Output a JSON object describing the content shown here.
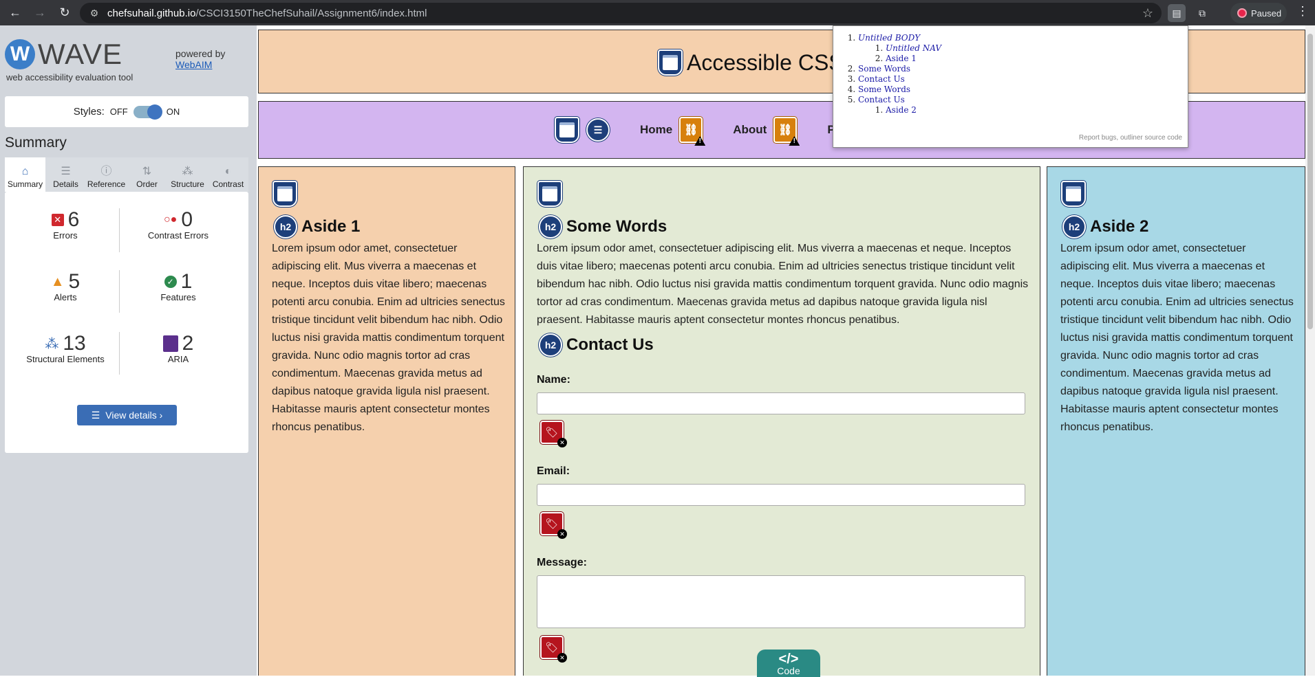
{
  "browser": {
    "url_host": "chefsuhail.github.io",
    "url_path": "/CSCI3150TheChefSuhail/Assignment6/index.html",
    "profile_status": "Paused"
  },
  "wave": {
    "logo_text": "WAVE",
    "tagline": "web accessibility evaluation tool",
    "powered_by": "powered by",
    "webaim": "WebAIM",
    "styles_label": "Styles:",
    "styles_off": "OFF",
    "styles_on": "ON",
    "summary_title": "Summary",
    "tabs": [
      {
        "label": "Summary",
        "icon": "home-icon"
      },
      {
        "label": "Details",
        "icon": "list-icon"
      },
      {
        "label": "Reference",
        "icon": "info-icon"
      },
      {
        "label": "Order",
        "icon": "order-icon"
      },
      {
        "label": "Structure",
        "icon": "structure-icon"
      },
      {
        "label": "Contrast",
        "icon": "contrast-icon"
      }
    ],
    "stats": {
      "errors": {
        "value": "6",
        "label": "Errors"
      },
      "contrast_errors": {
        "value": "0",
        "label": "Contrast Errors"
      },
      "alerts": {
        "value": "5",
        "label": "Alerts"
      },
      "features": {
        "value": "1",
        "label": "Features"
      },
      "structural": {
        "value": "13",
        "label": "Structural Elements"
      },
      "aria": {
        "value": "2",
        "label": "ARIA"
      }
    },
    "view_details": "View details ›"
  },
  "page": {
    "title": "Accessible CSS",
    "nav": {
      "home": "Home",
      "about": "About",
      "third": "Pro"
    },
    "aside1": {
      "heading": "Aside 1",
      "text": "Lorem ipsum odor amet, consectetuer adipiscing elit. Mus viverra a maecenas et neque. Inceptos duis vitae libero; maecenas potenti arcu conubia. Enim ad ultricies senectus tristique tincidunt velit bibendum hac nibh. Odio luctus nisi gravida mattis condimentum torquent gravida. Nunc odio magnis tortor ad cras condimentum. Maecenas gravida metus ad dapibus natoque gravida ligula nisl praesent. Habitasse mauris aptent consectetur montes rhoncus penatibus."
    },
    "main": {
      "heading": "Some Words",
      "text": "Lorem ipsum odor amet, consectetuer adipiscing elit. Mus viverra a maecenas et neque. Inceptos duis vitae libero; maecenas potenti arcu conubia. Enim ad ultricies senectus tristique tincidunt velit bibendum hac nibh. Odio luctus nisi gravida mattis condimentum torquent gravida. Nunc odio magnis tortor ad cras condimentum. Maecenas gravida metus ad dapibus natoque gravida ligula nisl praesent. Habitasse mauris aptent consectetur montes rhoncus penatibus.",
      "contact_heading": "Contact Us",
      "name_label": "Name:",
      "email_label": "Email:",
      "message_label": "Message:"
    },
    "aside2": {
      "heading": "Aside 2",
      "text": "Lorem ipsum odor amet, consectetuer adipiscing elit. Mus viverra a maecenas et neque. Inceptos duis vitae libero; maecenas potenti arcu conubia. Enim ad ultricies senectus tristique tincidunt velit bibendum hac nibh. Odio luctus nisi gravida mattis condimentum torquent gravida. Nunc odio magnis tortor ad cras condimentum. Maecenas gravida metus ad dapibus natoque gravida ligula nisl praesent. Habitasse mauris aptent consectetur montes rhoncus penatibus."
    },
    "h2_badge": "h2",
    "code_button": "Code"
  },
  "outliner": {
    "items": [
      {
        "label": "Untitled BODY",
        "children": [
          "Untitled NAV",
          "Aside 1"
        ]
      },
      {
        "label": "Some Words"
      },
      {
        "label": "Contact Us"
      },
      {
        "label": "Some Words"
      },
      {
        "label": "Contact Us",
        "children": [
          "Aside 2"
        ]
      }
    ],
    "footer": "Report bugs, outliner source code"
  },
  "colors": {
    "header": "#f5d0ad",
    "nav": "#d3b5f0",
    "main": "#e3ead5",
    "aside2": "#a8d8e6",
    "wave_accent": "#3a6db5"
  }
}
